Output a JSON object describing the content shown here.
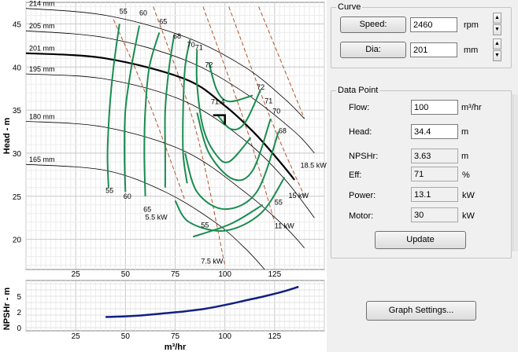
{
  "chart_data": [
    {
      "type": "line",
      "ylabel": "Head - m",
      "xlabel": "",
      "xlim": [
        0,
        150
      ],
      "ylim": [
        16.5,
        47.5
      ],
      "xticks": [
        25,
        50,
        75,
        100,
        125
      ],
      "yticks": [
        20,
        25,
        30,
        35,
        40,
        45
      ],
      "grid": true,
      "diameter_curves": [
        {
          "label": "214 mm",
          "points": [
            [
              0,
              46.8
            ],
            [
              40,
              46.0
            ],
            [
              80,
              43.5
            ],
            [
              110,
              40
            ],
            [
              130,
              36.3
            ],
            [
              140,
              34
            ]
          ]
        },
        {
          "label": "205 mm",
          "points": [
            [
              0,
              44.2
            ],
            [
              40,
              43.4
            ],
            [
              80,
              40.8
            ],
            [
              110,
              37
            ],
            [
              135,
              32.5
            ],
            [
              145,
              30
            ]
          ]
        },
        {
          "label": "201 mm",
          "points": [
            [
              0,
              41.6
            ],
            [
              40,
              41
            ],
            [
              80,
              38.6
            ],
            [
              100,
              35.5
            ],
            [
              115,
              32.3
            ],
            [
              128,
              28.9
            ],
            [
              135,
              26.9
            ]
          ],
          "selected": true
        },
        {
          "label": "195 mm",
          "points": [
            [
              0,
              39.2
            ],
            [
              40,
              38.6
            ],
            [
              80,
              36
            ],
            [
              110,
              31.5
            ],
            [
              130,
              27
            ],
            [
              145,
              22.5
            ]
          ]
        },
        {
          "label": "180 mm",
          "points": [
            [
              0,
              33.7
            ],
            [
              40,
              33
            ],
            [
              80,
              30.2
            ],
            [
              110,
              25.5
            ],
            [
              130,
              21.5
            ],
            [
              140,
              19
            ]
          ]
        },
        {
          "label": "165 mm",
          "points": [
            [
              0,
              28.7
            ],
            [
              40,
              28
            ],
            [
              70,
              25.5
            ],
            [
              95,
              22
            ],
            [
              110,
              19
            ],
            [
              120,
              16.5
            ]
          ]
        }
      ],
      "efficiency_curves": [
        {
          "label": "55",
          "points": [
            [
              47,
              45
            ],
            [
              44,
              40
            ],
            [
              42,
              35
            ],
            [
              41,
              30
            ],
            [
              41.5,
              26
            ]
          ]
        },
        {
          "label": "60",
          "points": [
            [
              57,
              44.8
            ],
            [
              53,
              40
            ],
            [
              50,
              35
            ],
            [
              49.5,
              30
            ],
            [
              50,
              25.5
            ]
          ]
        },
        {
          "label": "65",
          "points": [
            [
              67,
              44
            ],
            [
              62,
              40
            ],
            [
              60,
              35
            ],
            [
              59.5,
              30
            ],
            [
              60,
              25
            ]
          ]
        },
        {
          "label": "68",
          "points": [
            [
              74.5,
              43.7
            ],
            [
              72,
              40
            ],
            [
              70,
              35
            ],
            [
              70,
              30
            ],
            [
              70,
              26
            ]
          ]
        },
        {
          "label": "70",
          "points": [
            [
              82.5,
              43.2
            ],
            [
              80,
              40
            ],
            [
              79,
              35
            ],
            [
              79,
              30
            ],
            [
              81,
              26.5
            ]
          ]
        },
        {
          "label": "71",
          "points": [
            [
              86,
              42
            ],
            [
              86,
              38
            ],
            [
              89,
              33
            ],
            [
              95,
              30
            ],
            [
              102,
              29
            ],
            [
              113,
              31.8
            ]
          ]
        },
        {
          "label": "72",
          "points": [
            [
              92,
              40.5
            ],
            [
              96,
              37.3
            ],
            [
              102,
              36
            ],
            [
              114,
              36.7
            ]
          ]
        },
        {
          "label": "71",
          "points": [
            [
              118,
              37.4
            ],
            [
              110,
              33.5
            ],
            [
              103,
              32.8
            ],
            [
              96,
              34.5
            ]
          ]
        },
        {
          "label": "70",
          "points": [
            [
              123,
              34
            ],
            [
              114,
              28
            ],
            [
              104,
              27
            ],
            [
              92,
              30
            ],
            [
              86,
              34.7
            ]
          ]
        },
        {
          "label": "68",
          "points": [
            [
              127,
              32.5
            ],
            [
              116,
              25.5
            ],
            [
              100,
              23.5
            ],
            [
              86,
              25.5
            ],
            [
              80,
              30
            ]
          ]
        },
        {
          "label": "65",
          "points": [
            [
              130,
              27.2
            ],
            [
              118,
              23
            ],
            [
              100,
              21
            ],
            [
              82,
              22
            ],
            [
              75,
              24.5
            ]
          ]
        },
        {
          "label": "55",
          "points": [
            [
              119,
              24
            ],
            [
              103,
              21.8
            ],
            [
              84,
              20.3
            ]
          ]
        }
      ],
      "power_lines": [
        {
          "label": "5.5 kW",
          "points": [
            [
              44,
              45.5
            ],
            [
              60,
              37
            ],
            [
              80,
              24.5
            ]
          ]
        },
        {
          "label": "7.5 kW",
          "points": [
            [
              64,
              47
            ],
            [
              85,
              33
            ],
            [
              100,
              17
            ]
          ]
        },
        {
          "label": "11 kW",
          "points": [
            [
              89,
              47
            ],
            [
              110,
              33.5
            ],
            [
              125,
              22
            ]
          ]
        },
        {
          "label": "15 kW",
          "points": [
            [
              102,
              47
            ],
            [
              123,
              34
            ],
            [
              140,
              25
            ]
          ]
        },
        {
          "label": "18.5 kW",
          "points": [
            [
              117,
              47
            ],
            [
              140,
              34
            ]
          ]
        }
      ],
      "duty_point": {
        "flow": 100,
        "head": 34.4
      },
      "annotations": [
        "55",
        "60",
        "65",
        "68",
        "70",
        "71",
        "72",
        "72",
        "71",
        "70",
        "68",
        "55",
        "55",
        "60",
        "65",
        "55",
        "71.4",
        "5.5 kW",
        "7.5 kW",
        "11 kW",
        "15 kW",
        "18.5 kW"
      ]
    },
    {
      "type": "line",
      "ylabel": "NPSHr - m",
      "xlabel": "m³/hr",
      "xlim": [
        0,
        150
      ],
      "ylim": [
        -0.5,
        7.5
      ],
      "xticks": [
        25,
        50,
        75,
        100,
        125
      ],
      "yticks": [
        0,
        2.5,
        5
      ],
      "ytick_labels": [
        "0",
        "2",
        "5"
      ],
      "grid": true,
      "series": [
        {
          "points": [
            [
              40,
              1.7
            ],
            [
              50,
              1.8
            ],
            [
              60,
              2.0
            ],
            [
              70,
              2.3
            ],
            [
              80,
              2.6
            ],
            [
              90,
              3.0
            ],
            [
              100,
              3.6
            ],
            [
              110,
              4.3
            ],
            [
              120,
              5.0
            ],
            [
              130,
              5.8
            ],
            [
              137,
              6.5
            ]
          ]
        }
      ]
    }
  ],
  "curve_group": {
    "title": "Curve",
    "speed_label": "Speed:",
    "speed_value": "2460",
    "speed_unit": "rpm",
    "dia_label": "Dia:",
    "dia_value": "201",
    "dia_unit": "mm"
  },
  "datapoint_group": {
    "title": "Data Point",
    "flow_label": "Flow:",
    "flow_value": "100",
    "flow_unit": "m³/hr",
    "head_label": "Head:",
    "head_value": "34.4",
    "head_unit": "m",
    "npshr_label": "NPSHr:",
    "npshr_value": "3.63",
    "npshr_unit": "m",
    "eff_label": "Eff:",
    "eff_value": "71",
    "eff_unit": "%",
    "power_label": "Power:",
    "power_value": "13.1",
    "power_unit": "kW",
    "motor_label": "Motor:",
    "motor_value": "30",
    "motor_unit": "kW",
    "update_label": "Update"
  },
  "graph_settings_label": "Graph Settings...",
  "colors": {
    "eff": "#1a8c50",
    "power": "#b0562a",
    "dia": "#000000",
    "npsh": "#102080"
  }
}
